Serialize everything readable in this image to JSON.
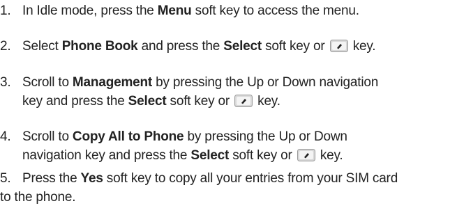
{
  "steps": [
    {
      "num": "1.",
      "l1": {
        "a": "In Idle mode, press the ",
        "b": "Menu",
        "c": " soft key to access the menu."
      }
    },
    {
      "num": "2.",
      "l1": {
        "a": "Select ",
        "b": "Phone Book",
        "c": " and press the ",
        "d": "Select",
        "e": " soft key or ",
        "f": " key."
      }
    },
    {
      "num": "3.",
      "l1": {
        "a": "Scroll to ",
        "b": "Management",
        "c": " by pressing the Up or Down navigation"
      },
      "l2": {
        "a": "key and press the ",
        "b": "Select",
        "c": " soft key or ",
        "d": " key."
      }
    },
    {
      "num": "4.",
      "l1": {
        "a": "Scroll to ",
        "b": "Copy All to Phone",
        "c": " by pressing the Up or Down"
      },
      "l2": {
        "a": "navigation key and press the ",
        "b": "Select",
        "c": " soft key or ",
        "d": " key."
      }
    },
    {
      "num": "5.",
      "l1": {
        "a": "Press the ",
        "b": "Yes",
        "c": " soft key to copy all your entries from your SIM card"
      },
      "l2": {
        "a": "to the phone."
      }
    }
  ],
  "icons": {
    "ok_key": "ok-key-icon"
  }
}
